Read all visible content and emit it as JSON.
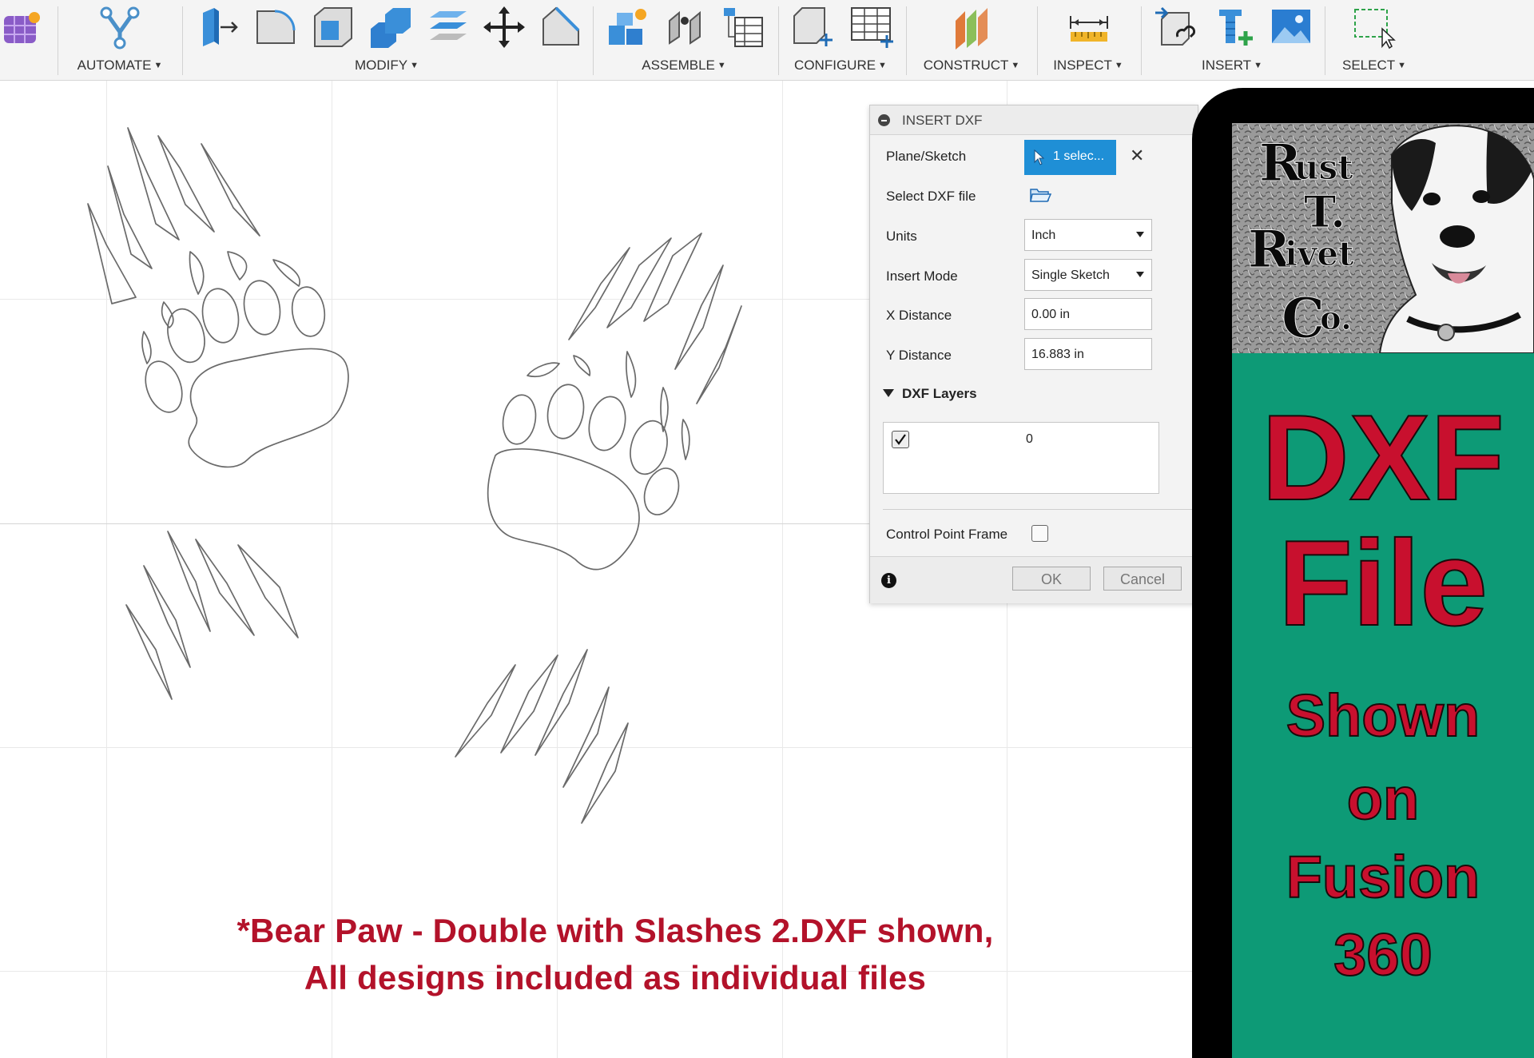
{
  "toolbar": {
    "groups": [
      {
        "label": "AUTOMATE"
      },
      {
        "label": "MODIFY"
      },
      {
        "label": "ASSEMBLE"
      },
      {
        "label": "CONFIGURE"
      },
      {
        "label": "CONSTRUCT"
      },
      {
        "label": "INSPECT"
      },
      {
        "label": "INSERT"
      },
      {
        "label": "SELECT"
      }
    ],
    "caret": "▾"
  },
  "dialog": {
    "title": "INSERT DXF",
    "plane_label": "Plane/Sketch",
    "plane_value": "1 selec...",
    "clear_symbol": "✕",
    "file_label": "Select DXF file",
    "units_label": "Units",
    "units_value": "Inch",
    "mode_label": "Insert Mode",
    "mode_value": "Single Sketch",
    "x_label": "X Distance",
    "x_value": "0.00 in",
    "y_label": "Y Distance",
    "y_value": "16.883 in",
    "layers_title": "DXF Layers",
    "layer_name": "0",
    "layer_checked": true,
    "cpf_label": "Control Point Frame",
    "cpf_checked": false,
    "info_symbol": "i",
    "ok_label": "OK",
    "cancel_label": "Cancel"
  },
  "caption": {
    "line1": "*Bear Paw - Double with Slashes 2.DXF shown,",
    "line2": "All designs included as individual files"
  },
  "promo": {
    "logo_letters": [
      "R",
      "ust",
      "T.",
      "R",
      "ivet",
      "C",
      "o."
    ],
    "big1": "DXF",
    "big2": "File",
    "line1": "Shown",
    "line2": "on",
    "line3": "Fusion",
    "line4": "360"
  },
  "colors": {
    "accent_blue": "#1f8fd6",
    "caption_red": "#b3122a",
    "promo_green": "#0d9a76",
    "promo_red": "#c8102e"
  }
}
